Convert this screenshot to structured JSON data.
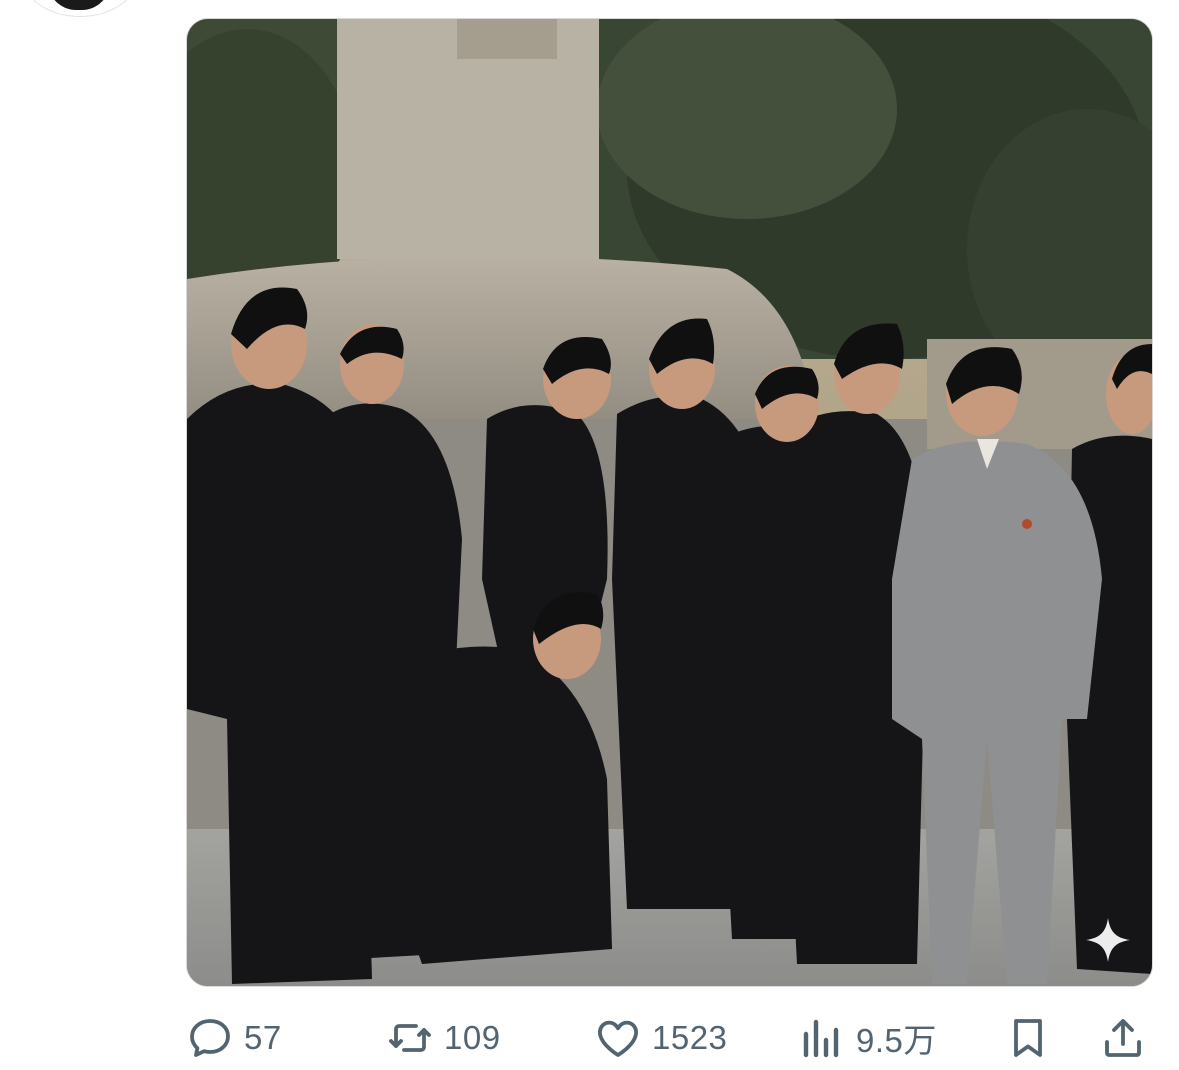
{
  "post": {
    "avatar_icon": "avatar-icon",
    "media_icon": "ai-sparkle-icon",
    "actions": {
      "reply": {
        "icon": "reply-icon",
        "count": "57"
      },
      "repost": {
        "icon": "repost-icon",
        "count": "109"
      },
      "like": {
        "icon": "heart-icon",
        "count": "1523"
      },
      "views": {
        "icon": "views-chart-icon",
        "count": "9.5万"
      },
      "bookmark": {
        "icon": "bookmark-icon"
      },
      "share": {
        "icon": "share-icon"
      }
    }
  },
  "colors": {
    "action_gray": "#536471",
    "border": "#d8d8d8"
  }
}
